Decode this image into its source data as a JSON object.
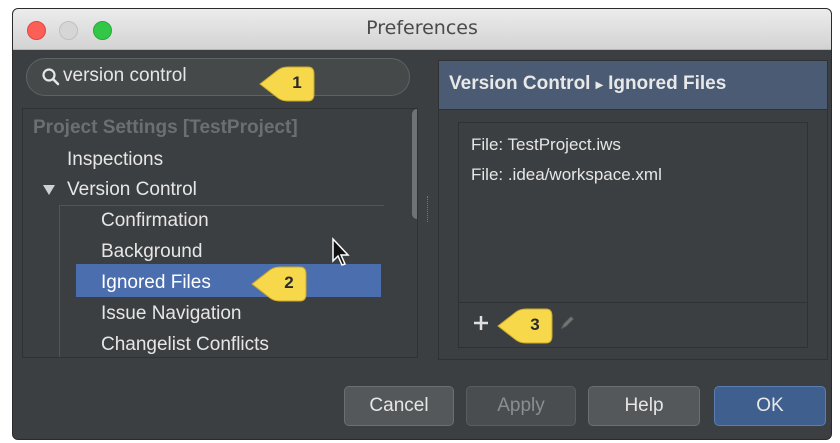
{
  "window": {
    "title": "Preferences"
  },
  "search": {
    "value": "version control"
  },
  "callouts": [
    "1",
    "2",
    "3"
  ],
  "tree": {
    "section_header": "Project Settings [TestProject]",
    "items": [
      "Inspections",
      "Version Control"
    ],
    "subitems": [
      "Confirmation",
      "Background",
      "Ignored Files",
      "Issue Navigation",
      "Changelist Conflicts"
    ],
    "selected": "Ignored Files"
  },
  "right_panel": {
    "breadcrumb_parent": "Version Control",
    "breadcrumb_sep": "▸",
    "breadcrumb_current": "Ignored Files",
    "files": [
      "File: TestProject.iws",
      "File: .idea/workspace.xml"
    ],
    "add_label": "+"
  },
  "buttons": {
    "cancel": "Cancel",
    "apply": "Apply",
    "help": "Help",
    "ok": "OK"
  },
  "colors": {
    "selection": "#4b6eaf",
    "callout": "#f7d84a",
    "header": "#4a5b73"
  }
}
